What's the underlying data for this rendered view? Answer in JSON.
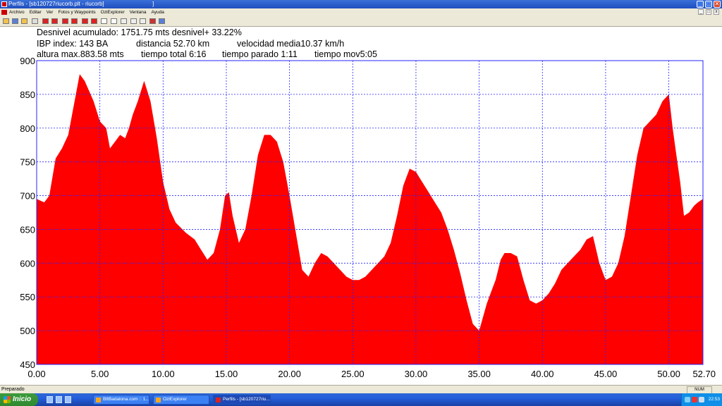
{
  "window": {
    "title": "Perfils - [sb120727riucorb.plt - riucorb]",
    "title_suffix": "]",
    "controls": [
      "_",
      "□",
      "✕"
    ]
  },
  "menu": {
    "items": [
      "Archivo",
      "Editar",
      "Ver",
      "Fotos y Waypoints",
      "OziExplorer",
      "Ventana",
      "Ayuda"
    ],
    "mdi_controls": [
      "_",
      "□",
      "x"
    ]
  },
  "toolbar": {
    "icons": [
      "open-icon",
      "save-icon",
      "folder-icon",
      "print-icon",
      "chart-icon",
      "chart-icon",
      "chart-icon",
      "chart-icon",
      "table-icon",
      "table-icon",
      "profile-icon",
      "profile-icon",
      "profile-icon",
      "flag-icon",
      "window-icon"
    ]
  },
  "stats": {
    "line1": "Desnivel acumulado: 1751.75 mts desnivel+ 33.22%",
    "line2_ibp": "IBP index: 143 BA",
    "line2_dist": "distancia 52.70 km",
    "line2_speed": "velocidad media10.37 km/h",
    "line3_alt": "altura max.883.58 mts",
    "line3_total": "tiempo total 6:16",
    "line3_stop": "tiempo parado 1:11",
    "line3_mov": "tiempo mov5:05"
  },
  "colors": {
    "fill": "#ff0000",
    "grid": "#2424ff",
    "titlebar": "#245edb",
    "taskbar": "#245edb",
    "start": "#3c9a3c"
  },
  "chart_data": {
    "type": "area",
    "title": "",
    "xlabel": "",
    "ylabel": "",
    "xlim": [
      0,
      52.7
    ],
    "ylim": [
      450,
      900
    ],
    "x_ticks": [
      0,
      5,
      10,
      15,
      20,
      25,
      30,
      35,
      40,
      45,
      50,
      52.7
    ],
    "x_tick_labels": [
      "0.00",
      "5.00",
      "10.00",
      "15.00",
      "20.00",
      "25.00",
      "30.00",
      "35.00",
      "40.00",
      "45.00",
      "50.00",
      "52.70"
    ],
    "y_ticks": [
      450,
      500,
      550,
      600,
      650,
      700,
      750,
      800,
      850,
      900
    ],
    "y_tick_labels": [
      "450",
      "500",
      "550",
      "600",
      "650",
      "700",
      "750",
      "800",
      "850",
      "900"
    ],
    "grid": true,
    "series": [
      {
        "x": [
          0,
          0.6,
          1.0,
          1.5,
          2.0,
          2.5,
          3.0,
          3.4,
          3.8,
          4.5,
          5.0,
          5.5,
          5.8,
          6.2,
          6.6,
          7.0,
          7.3,
          7.6,
          8.0,
          8.5,
          9.0,
          9.5,
          10.0,
          10.5,
          11.0,
          11.8,
          12.5,
          13.0,
          13.5,
          14.0,
          14.5,
          14.9,
          15.2,
          15.5,
          16.0,
          16.5,
          17.0,
          17.5,
          18.0,
          18.5,
          19.0,
          19.5,
          20.0,
          20.5,
          21.0,
          21.5,
          22.0,
          22.5,
          23.0,
          23.5,
          24.0,
          24.5,
          25.0,
          25.5,
          26.0,
          26.5,
          27.0,
          27.5,
          28.0,
          28.5,
          29.0,
          29.5,
          30.0,
          30.5,
          31.0,
          31.5,
          32.0,
          32.5,
          33.0,
          33.5,
          34.0,
          34.5,
          35.0,
          35.3,
          35.6,
          35.9,
          36.3,
          36.7,
          37.0,
          37.5,
          38.0,
          38.5,
          39.0,
          39.5,
          40.0,
          40.5,
          41.0,
          41.5,
          42.0,
          42.5,
          43.0,
          43.5,
          44.0,
          44.5,
          45.0,
          45.5,
          46.0,
          46.5,
          47.0,
          47.5,
          48.0,
          48.5,
          49.0,
          49.5,
          50.0,
          50.3,
          50.6,
          50.9,
          51.2,
          51.6,
          52.0,
          52.3,
          52.7
        ],
        "y": [
          695,
          690,
          700,
          755,
          770,
          790,
          840,
          880,
          870,
          840,
          810,
          800,
          770,
          780,
          790,
          785,
          800,
          820,
          840,
          870,
          840,
          785,
          720,
          680,
          660,
          645,
          635,
          620,
          605,
          615,
          650,
          700,
          705,
          670,
          630,
          650,
          700,
          760,
          790,
          790,
          780,
          750,
          700,
          645,
          590,
          580,
          600,
          615,
          610,
          600,
          590,
          580,
          575,
          575,
          580,
          590,
          600,
          610,
          630,
          670,
          715,
          740,
          735,
          720,
          705,
          690,
          675,
          650,
          620,
          585,
          545,
          510,
          500,
          520,
          540,
          555,
          575,
          605,
          615,
          615,
          610,
          575,
          545,
          540,
          545,
          555,
          570,
          590,
          600,
          610,
          620,
          635,
          640,
          600,
          575,
          580,
          600,
          640,
          700,
          760,
          800,
          810,
          820,
          840,
          850,
          800,
          760,
          720,
          670,
          675,
          685,
          690,
          695
        ]
      }
    ]
  },
  "status": {
    "text": "Preparado",
    "num": "NUM"
  },
  "taskbar": {
    "start_label": "Inicio",
    "tasks": [
      "BttBadalona.com :: 1...",
      "OziExplorer",
      "Perfils - [sb120727riu..."
    ],
    "clock": "22:53"
  }
}
